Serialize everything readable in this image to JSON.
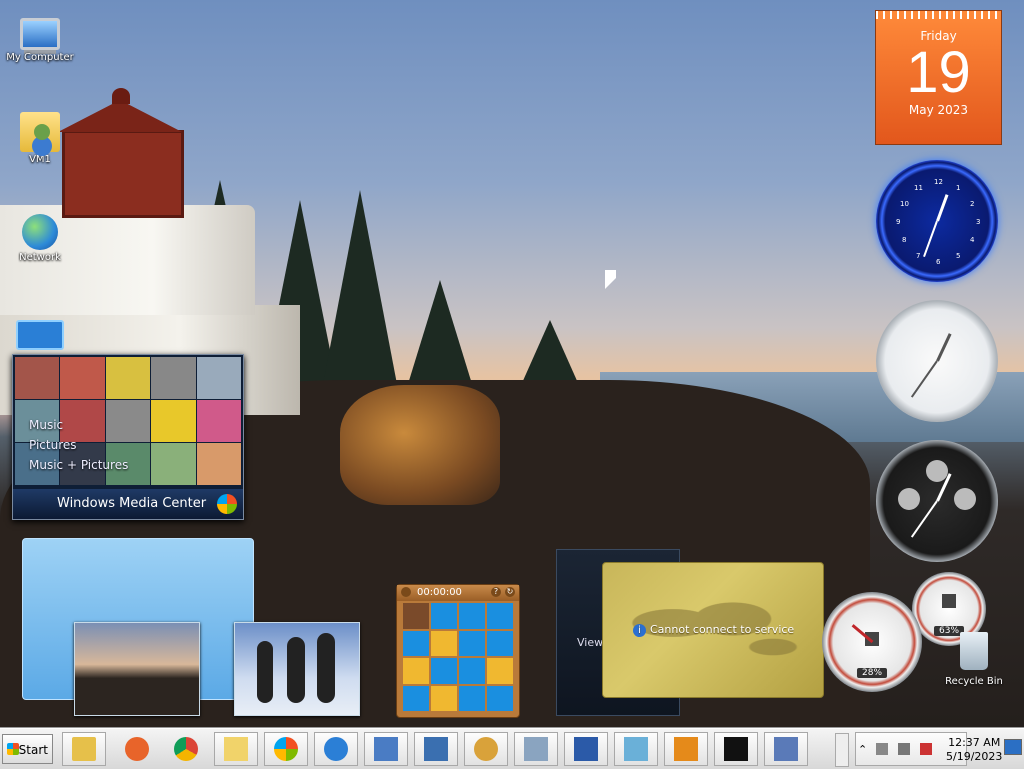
{
  "desktop": {
    "icons": [
      {
        "label": "My Computer",
        "icon": "computer-icon"
      },
      {
        "label": "VM1",
        "icon": "user-folder-icon"
      },
      {
        "label": "Network",
        "icon": "network-icon"
      },
      {
        "label": "",
        "icon": "control-panel-icon"
      }
    ],
    "recycle_bin": {
      "label": "Recycle Bin",
      "icon": "recycle-bin-icon"
    }
  },
  "gadgets": {
    "calendar": {
      "day": "Friday",
      "date": "19",
      "month_year": "May 2023"
    },
    "clock_blue": {
      "numbers": [
        "12",
        "1",
        "2",
        "3",
        "4",
        "5",
        "6",
        "7",
        "8",
        "9",
        "10",
        "11"
      ]
    },
    "media_center": {
      "menu": [
        "Music",
        "Pictures",
        "Music + Pictures"
      ],
      "title": "Windows Media Center"
    },
    "puzzle": {
      "timer": "00:00:00",
      "help": "?",
      "shuffle": "↻"
    },
    "feed": {
      "text": "View"
    },
    "stocks": {
      "message": "Cannot connect to service"
    },
    "cpu_meter": {
      "cpu": "28%",
      "memory": "63%"
    }
  },
  "taskbar": {
    "start_label": "Start",
    "pinned": [
      {
        "name": "windows-explorer-icon",
        "color": "#e6c04a"
      },
      {
        "name": "firefox-icon",
        "color": "#e8642a"
      },
      {
        "name": "chrome-icon",
        "color": "#3b8d3b"
      },
      {
        "name": "folder-icon",
        "color": "#f1d36a"
      },
      {
        "name": "windows-update-icon",
        "color": "#4c9a2a"
      },
      {
        "name": "internet-explorer-icon",
        "color": "#2b7fd6"
      },
      {
        "name": "on-screen-keyboard-icon",
        "color": "#4a7cc4"
      },
      {
        "name": "wordpad-icon",
        "color": "#3a6fb0"
      },
      {
        "name": "paint-icon",
        "color": "#d9a23a"
      },
      {
        "name": "calculator-icon",
        "color": "#8aa4c0"
      },
      {
        "name": "remote-desktop-icon",
        "color": "#2b5aa8"
      },
      {
        "name": "notepad-icon",
        "color": "#6ab0d8"
      },
      {
        "name": "media-player-icon",
        "color": "#e58a1a"
      },
      {
        "name": "7zip-icon",
        "color": "#111111"
      },
      {
        "name": "lambda-icon",
        "color": "#5a7ab8"
      }
    ],
    "tray": {
      "time": "12:37 AM",
      "date": "5/19/2023"
    }
  }
}
